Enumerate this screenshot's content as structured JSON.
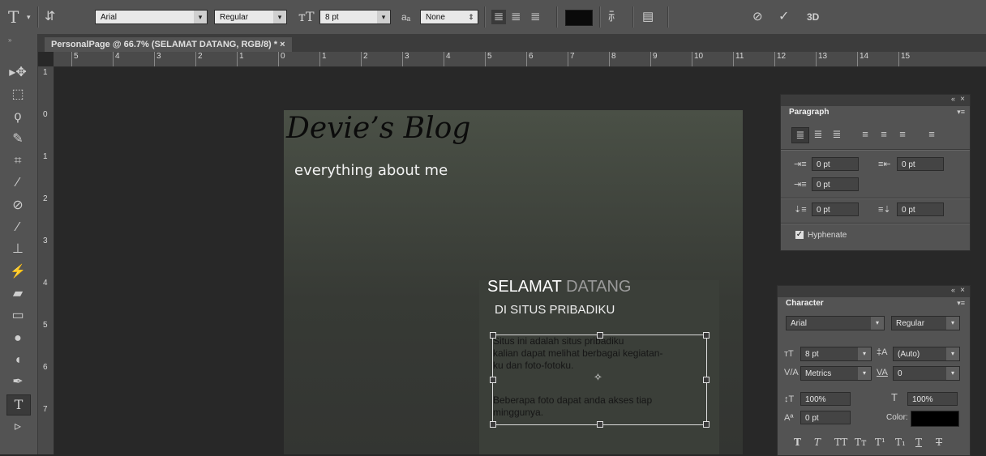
{
  "options_bar": {
    "tool_icon": "type-tool-icon",
    "font_family": "Arial",
    "font_style": "Regular",
    "font_size": "8 pt",
    "antialias": "None",
    "aa_label": "aₐ",
    "text_color": "#0a0a0a",
    "three_d_label": "3D"
  },
  "document": {
    "tab_title": "PersonalPage @ 66.7% (SELAMAT DATANG, RGB/8) * ×",
    "ruler_h": [
      "5",
      "4",
      "3",
      "2",
      "1",
      "0",
      "1",
      "2",
      "3",
      "4",
      "5",
      "6",
      "7",
      "8",
      "9",
      "10",
      "11",
      "12",
      "13",
      "14",
      "15"
    ],
    "ruler_v": [
      "1",
      "0",
      "1",
      "2",
      "3",
      "4",
      "5",
      "6",
      "7"
    ]
  },
  "canvas": {
    "title": "Devie’s Blog",
    "subtitle": "everything about me",
    "welcome_word1": "SELAMAT",
    "welcome_word2": " DATANG",
    "welcome_sub": "DI SITUS PRIBADIKU",
    "paragraph1": "Situs ini adalah situs pribadiku\nkalian dapat melihat berbagai kegiatan-\nku dan foto-fotoku.",
    "paragraph2": "Beberapa foto dapat anda akses tiap\nminggunya."
  },
  "paragraph_panel": {
    "title": "Paragraph",
    "indent_left": "0 pt",
    "indent_right": "0 pt",
    "indent_first": "0 pt",
    "space_before": "0 pt",
    "space_after": "0 pt",
    "hyphenate_label": "Hyphenate",
    "hyphenate_checked": true
  },
  "character_panel": {
    "title": "Character",
    "font_family": "Arial",
    "font_style": "Regular",
    "font_size": "8 pt",
    "leading": "(Auto)",
    "kerning": "Metrics",
    "tracking": "0",
    "vertical_scale": "100%",
    "horizontal_scale": "100%",
    "baseline_shift": "0 pt",
    "color_label": "Color:",
    "color": "#000000",
    "style_buttons": [
      "T",
      "T",
      "TT",
      "Tт",
      "T¹",
      "T₁",
      "T",
      "T"
    ]
  }
}
